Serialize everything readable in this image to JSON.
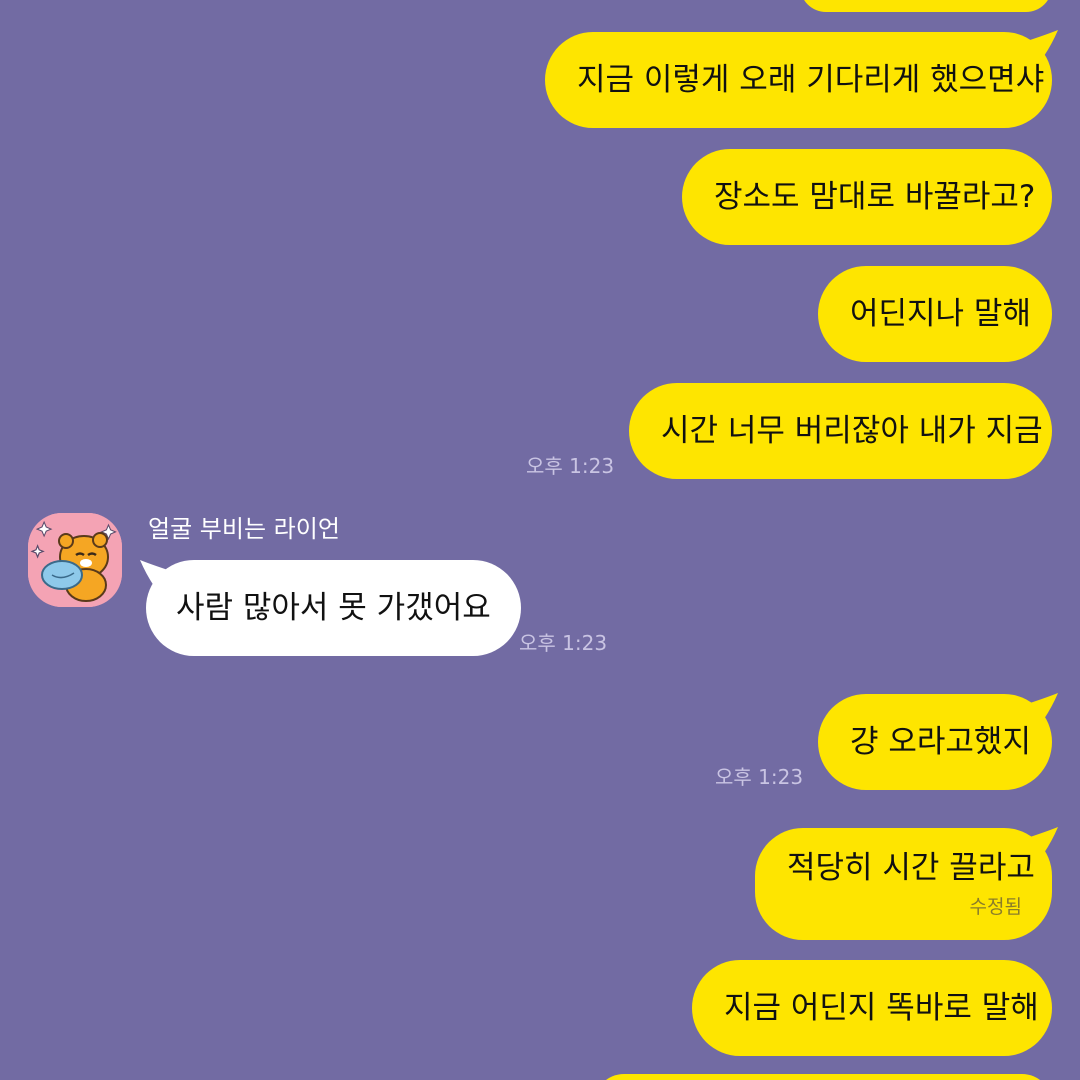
{
  "messages": {
    "m1": {
      "text": "지금 이렇게 오래 기다리게 했으면샤"
    },
    "m2": {
      "text": "장소도 맘대로 바꿀라고?"
    },
    "m3": {
      "text": "어딘지나 말해"
    },
    "m4": {
      "text": "시간 너무 버리잖아 내가 지금",
      "time": "오후 1:23"
    },
    "m5": {
      "sender": "얼굴 부비는 라이언",
      "text": "사람 많아서 못 가갰어요",
      "time": "오후 1:23"
    },
    "m6": {
      "text": "걍 오라고했지",
      "time": "오후 1:23"
    },
    "m7": {
      "text": "적당히 시간 끌라고",
      "edited": "수정됨"
    },
    "m8": {
      "text": "지금 어딘지 똑바로 말해"
    }
  },
  "colors": {
    "background": "#726ba3",
    "my_bubble": "#fee500",
    "their_bubble": "#ffffff"
  },
  "icons": {
    "avatar": "ryan-hugging-pillow-sticker"
  }
}
